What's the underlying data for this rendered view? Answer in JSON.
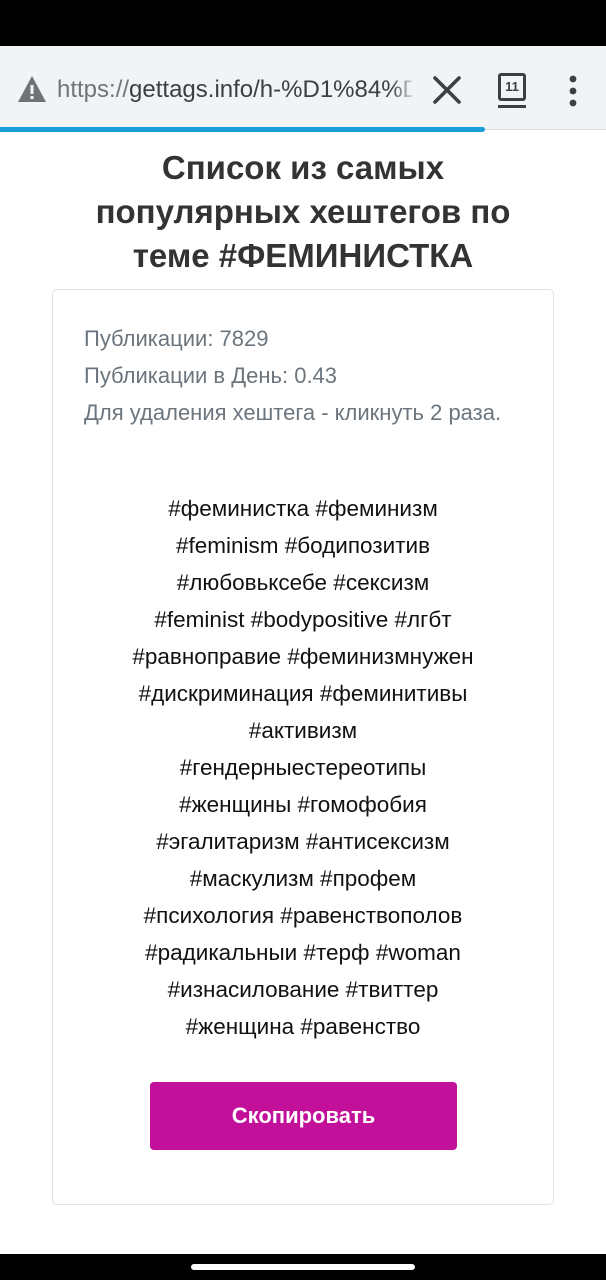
{
  "browser": {
    "url_scheme": "https://",
    "url_rest": "gettags.info/h-%D1%84%D0%B5",
    "tab_count": "11",
    "page_load_progress": 0.8,
    "accent_color": "#1a9fd8"
  },
  "icons": {
    "warning": "warning-triangle-icon",
    "close": "close-icon",
    "tabs": "tab-switcher-icon",
    "menu": "three-dot-menu-icon"
  },
  "page": {
    "title": "Список из самых популярных хештегов по теме #ФЕМИНИСТКА",
    "stats": {
      "posts": "Публикации: 7829",
      "posts_per_day": "Публикации в День: 0.43",
      "hint": "Для удаления хештега - кликнуть 2 раза."
    },
    "hashtag_lines": [
      "#феминистка #феминизм",
      "#feminism #бодипозитив",
      "#любовьксебе #сексизм",
      "#feminist #bodypositive #лгбт",
      "#равноправие #феминизмнужен",
      "#дискриминация #феминитивы",
      "#активизм",
      "#гендерныестереотипы",
      "#женщины #гомофобия",
      "#эгалитаризм #антисексизм",
      "#маскулизм #профем",
      "#психология #равенствополов",
      "#радикальныи #терф #woman",
      "#изнасилование #твиттер",
      "#женщина #равенство"
    ],
    "copy_button_label": "Скопировать",
    "button_color": "#c2109a"
  }
}
